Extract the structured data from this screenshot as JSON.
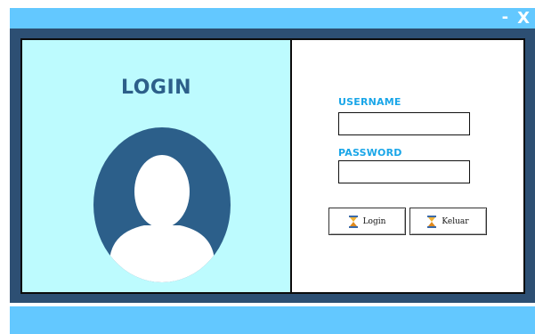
{
  "window": {
    "minimize_label": "-",
    "close_label": "X"
  },
  "left_panel": {
    "title": "LOGIN",
    "avatar_icon": "user-avatar-icon"
  },
  "form": {
    "username_label": "USERNAME",
    "username_value": "",
    "password_label": "PASSWORD",
    "password_value": ""
  },
  "buttons": {
    "login_label": "Login",
    "exit_label": "Keluar",
    "icon": "hourglass-icon"
  },
  "colors": {
    "titlebar": "#63c8ff",
    "frame": "#2d4f73",
    "left_panel_bg": "#bdfbfe",
    "title_text": "#2c5f8a",
    "label_text": "#1aa6e8",
    "avatar": "#2c5f8a"
  }
}
